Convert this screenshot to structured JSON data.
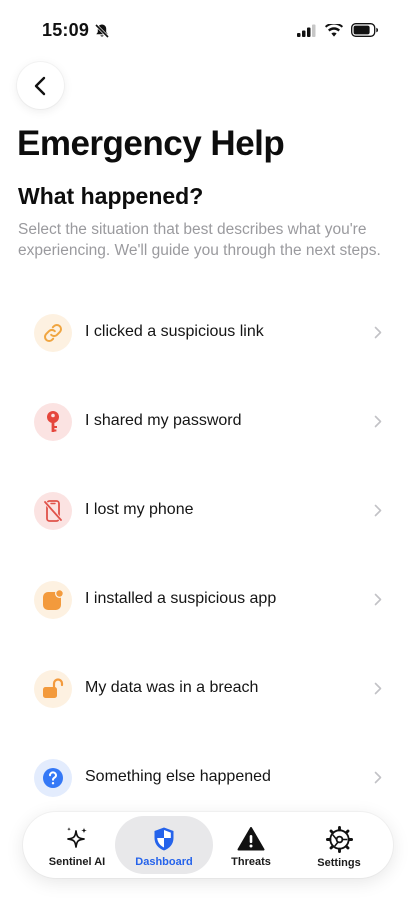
{
  "status_bar": {
    "time": "15:09",
    "icons": [
      "bell-slash-icon",
      "signal-icon",
      "wifi-icon",
      "battery-icon"
    ]
  },
  "header": {
    "back_icon": "chevron-left-icon",
    "title": "Emergency Help"
  },
  "section": {
    "title": "What happened?",
    "description": "Select the situation that best describes what you're experiencing. We'll guide you through the next steps."
  },
  "options": [
    {
      "label": "I clicked a suspicious link",
      "icon": "link-icon",
      "color": "#f0a540",
      "bg": "#fdf1e1"
    },
    {
      "label": "I shared my password",
      "icon": "key-icon",
      "color": "#e5463c",
      "bg": "#fbe3e2"
    },
    {
      "label": "I lost my phone",
      "icon": "phone-slash-icon",
      "color": "#e0524a",
      "bg": "#fbe3e2"
    },
    {
      "label": "I installed a suspicious app",
      "icon": "app-badge-icon",
      "color": "#f39a3c",
      "bg": "#fdf1e1"
    },
    {
      "label": "My data was in a breach",
      "icon": "unlock-icon",
      "color": "#f39a3c",
      "bg": "#fdf1e1"
    },
    {
      "label": "Something else happened",
      "icon": "question-icon",
      "color": "#3478f6",
      "bg": "#e3ecfd"
    }
  ],
  "tab_bar": {
    "tabs": [
      {
        "label": "Sentinel AI",
        "icon": "sparkles-icon",
        "active": false
      },
      {
        "label": "Dashboard",
        "icon": "shield-icon",
        "active": true
      },
      {
        "label": "Threats",
        "icon": "warning-icon",
        "active": false
      },
      {
        "label": "Settings",
        "icon": "gear-icon",
        "active": false
      }
    ],
    "accent": "#2563eb"
  }
}
